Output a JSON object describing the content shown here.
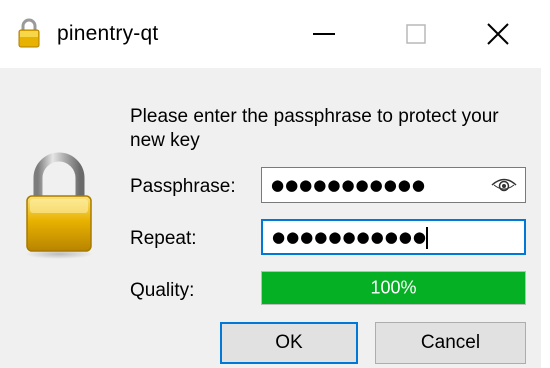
{
  "window": {
    "title": "pinentry-qt",
    "title_icon": "padlock-icon",
    "controls": [
      "minimize-icon",
      "maximize-icon",
      "close-icon"
    ]
  },
  "dialog": {
    "prompt": "Please enter the passphrase to protect your new key",
    "icon": "padlock-icon",
    "passphrase": {
      "label": "Passphrase:",
      "masked_value": "●●●●●●●●●●●",
      "toggle_icon": "eye-icon"
    },
    "repeat": {
      "label": "Repeat:",
      "masked_value": "●●●●●●●●●●●"
    },
    "quality": {
      "label": "Quality:",
      "value_text": "100%",
      "value_fraction": 1.0,
      "color": "#06b025"
    },
    "buttons": {
      "ok": "OK",
      "cancel": "Cancel"
    }
  },
  "colors": {
    "focus": "#0078d7",
    "background": "#f0f0f0"
  }
}
